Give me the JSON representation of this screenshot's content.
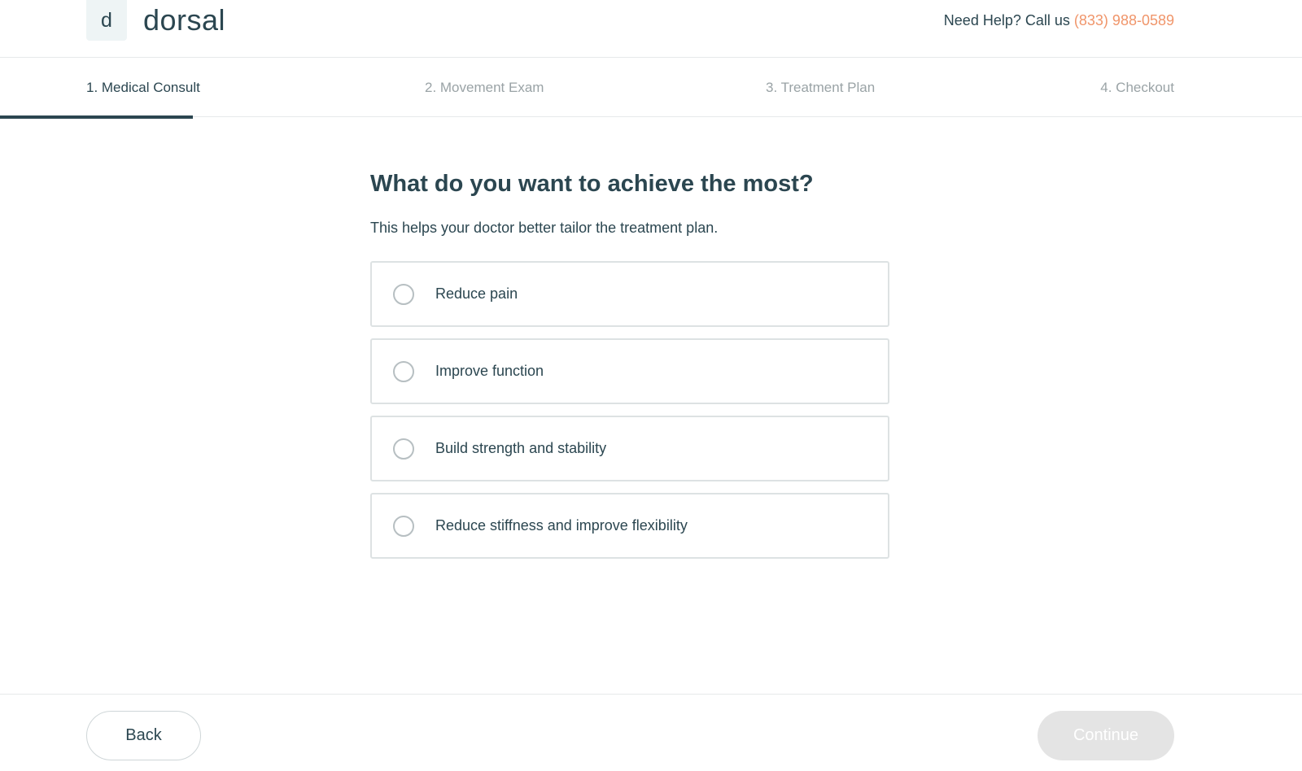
{
  "header": {
    "logo_mark": "d",
    "brand": "dorsal",
    "help_text": "Need Help? Call us",
    "phone": "(833) 988-0589"
  },
  "steps": [
    {
      "label": "1. Medical Consult",
      "active": true
    },
    {
      "label": "2. Movement Exam",
      "active": false
    },
    {
      "label": "3. Treatment Plan",
      "active": false
    },
    {
      "label": "4. Checkout",
      "active": false
    }
  ],
  "progress_fraction": 0.15,
  "question": {
    "title": "What do you want to achieve the most?",
    "subtitle": "This helps your doctor better tailor the treatment plan."
  },
  "options": [
    {
      "label": "Reduce pain",
      "selected": false
    },
    {
      "label": "Improve function",
      "selected": false
    },
    {
      "label": "Build strength and stability",
      "selected": false
    },
    {
      "label": "Reduce stiffness and improve flexibility",
      "selected": false
    }
  ],
  "footer": {
    "back_label": "Back",
    "continue_label": "Continue",
    "continue_enabled": false
  },
  "colors": {
    "primary": "#2b4650",
    "accent": "#f0956a",
    "disabled": "#e4e4e4"
  }
}
